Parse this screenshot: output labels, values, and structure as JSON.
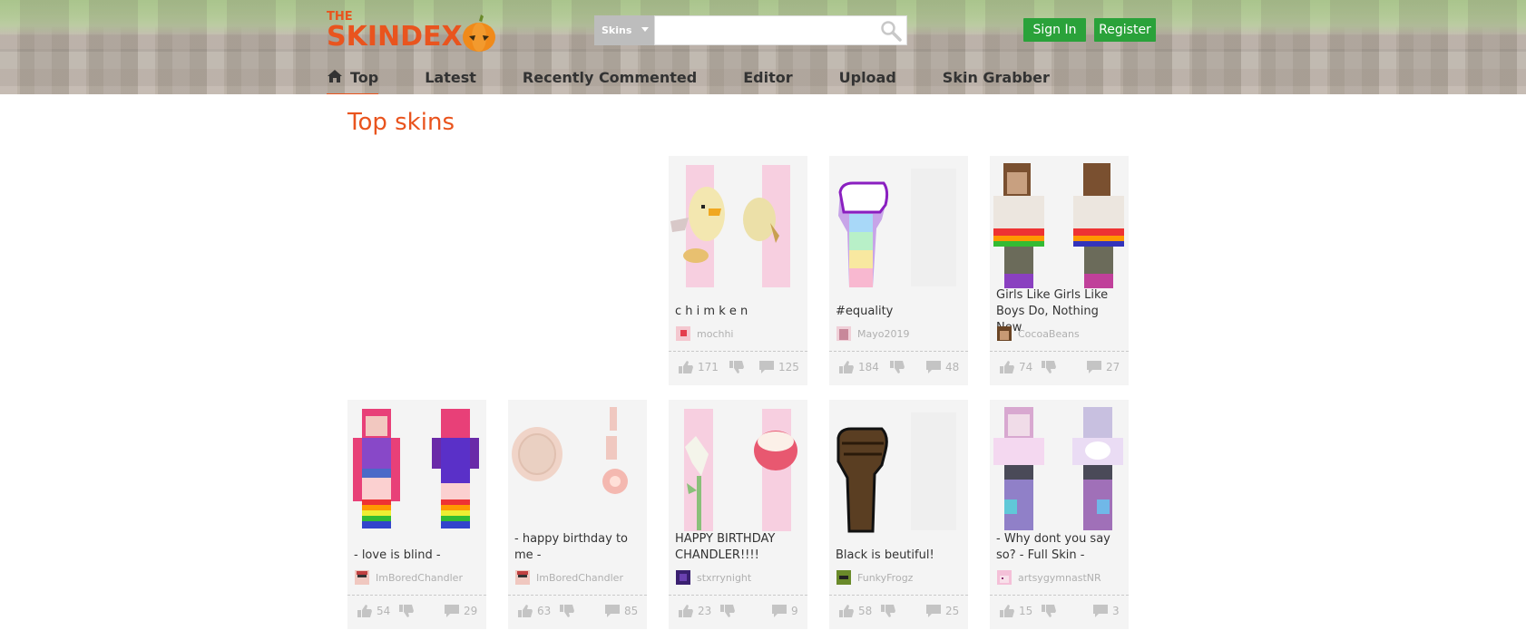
{
  "logo": {
    "the": "THE",
    "name": "SKINDEX"
  },
  "search": {
    "category": "Skins",
    "placeholder": ""
  },
  "auth": {
    "sign_in": "Sign In",
    "register": "Register"
  },
  "nav": [
    {
      "label": "Top",
      "active": true
    },
    {
      "label": "Latest"
    },
    {
      "label": "Recently Commented"
    },
    {
      "label": "Editor"
    },
    {
      "label": "Upload"
    },
    {
      "label": "Skin Grabber"
    }
  ],
  "page_title": "Top skins",
  "skins": [
    {
      "title": "c h i m k e n",
      "owner": "mochhi",
      "likes": "171",
      "comments": "125"
    },
    {
      "title": "#equality",
      "owner": "Mayo2019",
      "likes": "184",
      "comments": "48"
    },
    {
      "title": "Girls Like Girls Like Boys Do, Nothing New",
      "owner": "CocoaBeans",
      "likes": "74",
      "comments": "27"
    },
    {
      "title": "- love is blind -",
      "owner": "ImBoredChandler",
      "likes": "54",
      "comments": "29"
    },
    {
      "title": "- happy birthday to me -",
      "owner": "ImBoredChandler",
      "likes": "63",
      "comments": "85"
    },
    {
      "title": "HAPPY BIRTHDAY CHANDLER!!!!",
      "owner": "stxrrynight",
      "likes": "23",
      "comments": "9"
    },
    {
      "title": "Black is beutiful!",
      "owner": "FunkyFrogz",
      "likes": "58",
      "comments": "25"
    },
    {
      "title": "- Why dont you say so? - Full Skin -",
      "owner": "artsygymnastNR",
      "likes": "15",
      "comments": "3"
    }
  ]
}
